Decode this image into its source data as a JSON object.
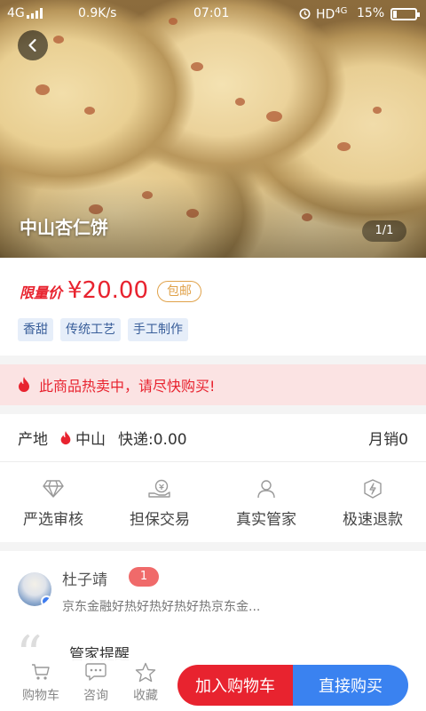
{
  "status_bar": {
    "network": "4G",
    "speed": "0.9K/s",
    "time": "07:01",
    "hd_label": "HD",
    "net_4g": "4G",
    "battery": "15%"
  },
  "product": {
    "title": "中山杏仁饼",
    "pager": "1/1",
    "limit_label": "限量价",
    "price": "¥20.00",
    "free_shipping": "包邮",
    "tags": [
      "香甜",
      "传统工艺",
      "手工制作"
    ]
  },
  "hot_banner": {
    "text": "此商品热卖中，请尽快购买!",
    "icon": "flame-icon"
  },
  "origin": {
    "label": "产地",
    "city": "中山",
    "shipping": "快递:0.00",
    "monthly_sales": "月销0"
  },
  "features": [
    {
      "label": "严选审核",
      "icon": "diamond-icon"
    },
    {
      "label": "担保交易",
      "icon": "guarantee-icon"
    },
    {
      "label": "真实管家",
      "icon": "person-icon"
    },
    {
      "label": "极速退款",
      "icon": "refund-icon"
    }
  ],
  "review": {
    "name": "杜子靖",
    "count": "1",
    "text": "京东金融好热好热好热好热京东金..."
  },
  "tip": {
    "title": "管家提醒"
  },
  "bottom_bar": {
    "cart_label": "购物车",
    "consult_label": "咨询",
    "favorite_label": "收藏",
    "add_to_cart": "加入购物车",
    "buy_now": "直接购买"
  },
  "colors": {
    "accent_red": "#e8232f",
    "accent_blue": "#3a82f0",
    "tag_bg": "#e6eef9",
    "banner_bg": "#fbe3e3"
  }
}
